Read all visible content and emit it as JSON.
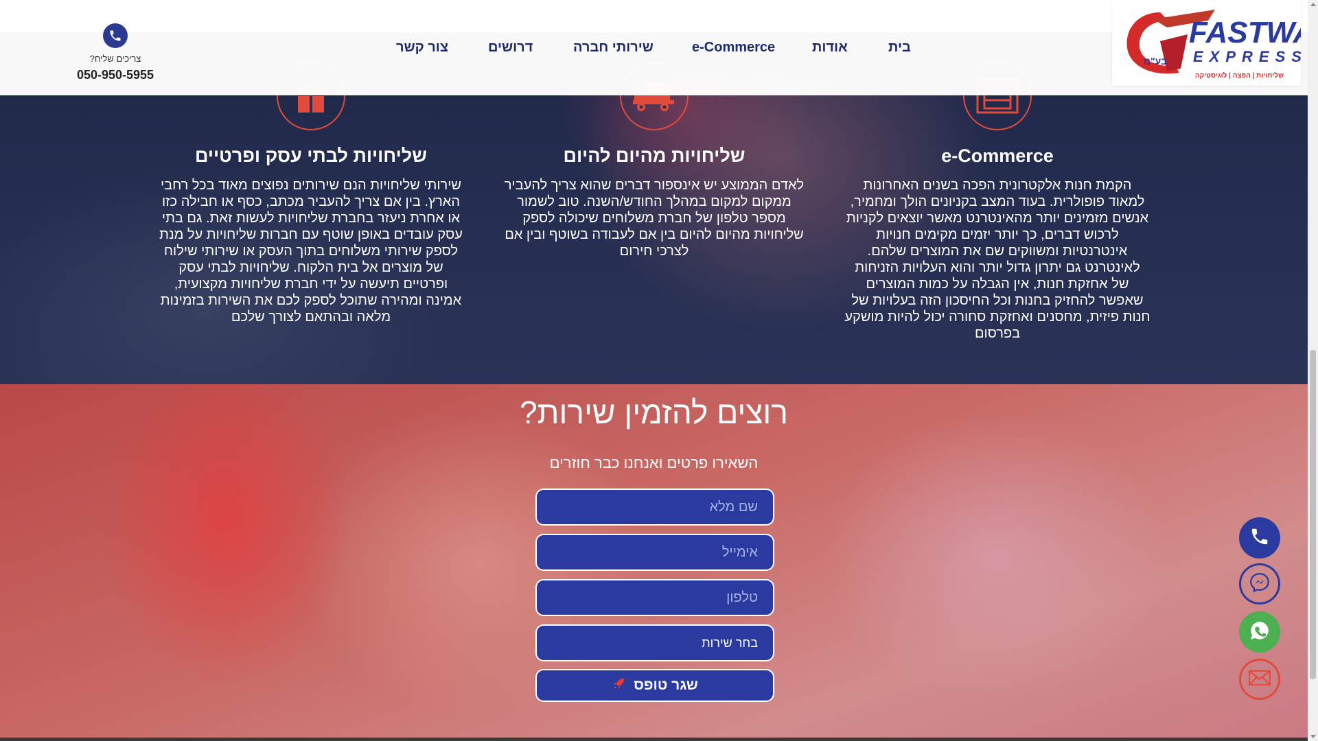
{
  "header": {
    "logo": {
      "brand_main": "FASTWAY",
      "brand_sub": "EXPRESS",
      "company_suffix": "בע\"מ",
      "tagline": "שליחויות | הפצה | לוגיסטיקה"
    },
    "nav": [
      {
        "label": "בית"
      },
      {
        "label": "אודות"
      },
      {
        "label": "e-Commerce"
      },
      {
        "label": "שירותי חברה"
      },
      {
        "label": "דרושים"
      },
      {
        "label": "צור קשר"
      }
    ],
    "contact": {
      "label": "צריכים שליח?",
      "phone": "050-950-5955"
    }
  },
  "services": [
    {
      "icon": "store-icon",
      "title": "e-Commerce",
      "text": "הקמת חנות אלקטרונית הפכה בשנים האחרונות למאוד פופולרית. בעוד המצב בקניונים הולך ומחמיר, אנשים מזמינים יותר מהאינטרנט מאשר יוצאים לקניות לרכוש דברים, כך יותר יזמים מקימים חנויות אינטרנטיות ומשווקים שם את המוצרים שלהם. לאינטרנט גם יתרון גדול יותר והוא העלויות הזניחות של אחזקת חנות, אין הגבלה על כמות המוצרים שאפשר להחזיק בחנות וכל החיסכון הזה בעלויות של חנות פיזית, מחסנים ואחזקת סחורה יכול להיות מושקע בפרסום"
    },
    {
      "icon": "delivery-truck-icon",
      "title": "שליחויות מהיום להיום",
      "text": "לאדם הממוצע יש אינספור דברים שהוא צריך להעביר ממקום למקום במהלך החודש/השנה. טוב לשמור מספר טלפון של חברת משלוחים שיכולה לספק שליחויות מהיום להיום בין אם לעבודה בשוטף ובין אם לצרכי חירום"
    },
    {
      "icon": "gift-icon",
      "title": "שליחויות לבתי עסק ופרטיים",
      "text": "שירותי שליחויות הנם שירותים נפוצים מאוד בכל רחבי הארץ. בין אם צריך להעביר מכתב, כסף או חבילה כזו או אחרת ניעזר בחברת שליחויות לעשות זאת. גם בתי עסק עובדים באופן שוטף עם חברות שליחויות על מנת לספק שירותי משלוחים בתוך העסק או שירותי שילוח של מוצרים אל בית הלקוח. שליחויות לבתי עסק ופרטיים תיעשה על ידי חברת שליחויות מקצועית, אמינה ומהירה שתוכל לספק לכם את השירות בזמינות מלאה ובהתאם לצורך שלכם"
    }
  ],
  "form": {
    "title": "רוצים להזמין שירות?",
    "subtitle": "השאירו פרטים ואנחנו כבר חוזרים",
    "name_placeholder": "שם מלא",
    "email_placeholder": "אימייל",
    "phone_placeholder": "טלפון",
    "service_select": "בחר שירות",
    "submit_label": "שגר טופס"
  },
  "floating": [
    "phone-icon",
    "messenger-icon",
    "whatsapp-icon",
    "email-icon"
  ],
  "colors": {
    "navy": "#2b3a9e",
    "nav_text": "#1f2a6b",
    "accent_red": "#e24a3b",
    "whatsapp_green": "#4caf50"
  }
}
